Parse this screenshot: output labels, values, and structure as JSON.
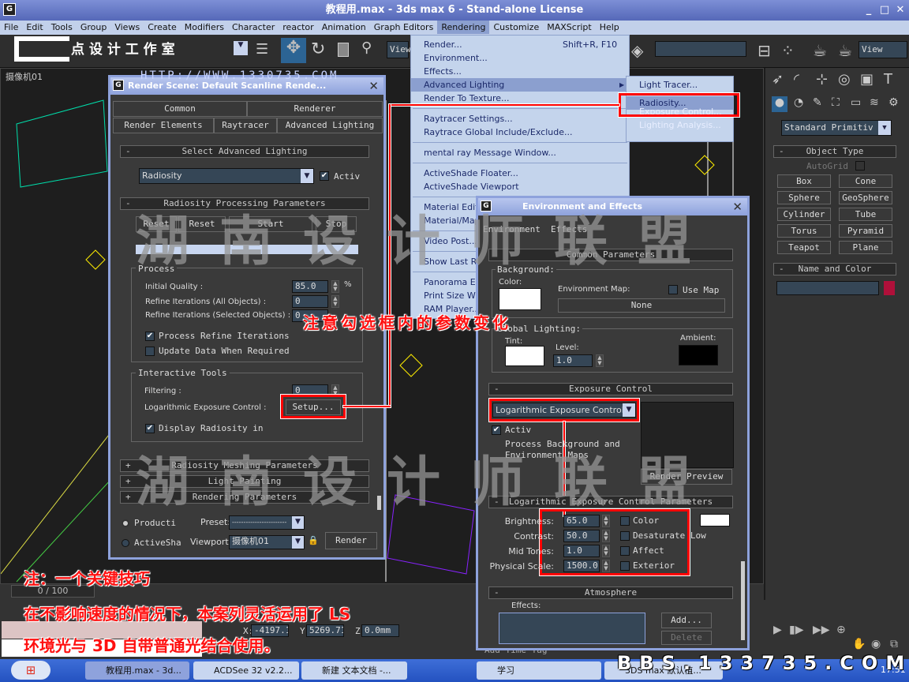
{
  "window": {
    "title": "教程用.max - 3ds max 6 - Stand-alone License"
  },
  "menubar": [
    "File",
    "Edit",
    "Tools",
    "Group",
    "Views",
    "Create",
    "Modifiers",
    "Character",
    "reactor",
    "Animation",
    "Graph Editors",
    "Rendering",
    "Customize",
    "MAXScript",
    "Help"
  ],
  "toolbar": {
    "logo_text": "点 设 计 工 作 室",
    "url_watermark": "HTTP://WWW.1330735.COM",
    "view_left": "View",
    "view_right": "View"
  },
  "viewport": {
    "label": "摄像机01"
  },
  "rendering_menu": {
    "items": [
      {
        "label": "Render...",
        "shortcut": "Shift+R, F10"
      },
      {
        "label": "Environment..."
      },
      {
        "label": "Effects..."
      },
      {
        "label": "Advanced Lighting",
        "submenu": true
      },
      {
        "label": "Render To Texture..."
      },
      {
        "label": "Raytracer Settings..."
      },
      {
        "label": "Raytrace Global Include/Exclude..."
      },
      {
        "label": "mental ray Message Window..."
      },
      {
        "label": "ActiveShade Floater..."
      },
      {
        "label": "ActiveShade Viewport"
      },
      {
        "label": "Material Edito"
      },
      {
        "label": "Material/Map"
      },
      {
        "label": "Video Post..."
      },
      {
        "label": "Show Last Re"
      },
      {
        "label": "Panorama Ex"
      },
      {
        "label": "Print Size Wiz"
      },
      {
        "label": "RAM Player..."
      }
    ],
    "submenu": [
      "Light Tracer...",
      "Radiosity...",
      "Exposure Control...",
      "Lighting Analysis..."
    ]
  },
  "render_scene": {
    "title": "Render Scene: Default Scanline Rende...",
    "tabs_row1": [
      "Common",
      "Renderer"
    ],
    "tabs_row2": [
      "Render Elements",
      "Raytracer",
      "Advanced Lighting"
    ],
    "select_rollout": "Select Advanced Lighting",
    "lighting_select": "Radiosity",
    "active_label": "Activ",
    "active_checked": true,
    "processing_rollout": "Radiosity Processing Parameters",
    "buttons": [
      "Reset All",
      "Reset",
      "Start",
      "Stop"
    ],
    "process_group": "Process",
    "initial_quality_label": "Initial Quality :",
    "initial_quality": "85.0",
    "percent": "%",
    "refine_all_label": "Refine Iterations (All Objects) :",
    "refine_all": "0",
    "refine_sel_label": "Refine Iterations (Selected Objects) :",
    "refine_sel": "0",
    "process_refine_label": "Process Refine Iterations",
    "process_refine_checked": true,
    "update_data_label": "Update Data When Required",
    "update_data_checked": false,
    "interactive_group": "Interactive Tools",
    "filtering_label": "Filtering :",
    "filtering": "0",
    "log_exposure_label": "Logarithmic Exposure Control :",
    "setup_button": "Setup...",
    "display_radiosity_label": "Display Radiosity in",
    "display_radiosity_checked": true,
    "collapsed_rollouts": [
      "Radiosity Meshing Parameters",
      "Light Painting",
      "Rendering Parameters"
    ],
    "production_label": "Producti",
    "activeshade_label": "ActiveSha",
    "preset_label": "Preset:",
    "preset_value": "------------------------",
    "viewport_label": "Viewport:",
    "viewport_value": "摄像机01",
    "render_button": "Render"
  },
  "env_effects": {
    "title": "Environment and Effects",
    "tabs": [
      "Environment",
      "Effects"
    ],
    "common_rollout": "Common Parameters",
    "background_group": "Background:",
    "color_label": "Color:",
    "env_map_label": "Environment Map:",
    "use_map_label": "Use Map",
    "map_button": "None",
    "global_lighting_group": "Global Lighting:",
    "tint_label": "Tint:",
    "level_label": "Level:",
    "level": "1.0",
    "ambient_label": "Ambient:",
    "exposure_rollout": "Exposure Control",
    "exposure_select": "Logarithmic Exposure Control",
    "active_label": "Activ",
    "active_checked": true,
    "process_bg_label": "Process Background and Environment Maps",
    "render_preview_button": "Render Preview",
    "log_rollout": "Logarithmic Exposure Control Parameters",
    "params": [
      {
        "label": "Brightness:",
        "value": "65.0",
        "check": "Color"
      },
      {
        "label": "Contrast:",
        "value": "50.0",
        "check": "Desaturate Low"
      },
      {
        "label": "Mid Tones:",
        "value": "1.0",
        "check": "Affect"
      },
      {
        "label": "Physical Scale:",
        "value": "1500.0",
        "check": "Exterior"
      }
    ],
    "atmosphere_rollout": "Atmosphere",
    "effects_label": "Effects:",
    "add_button": "Add...",
    "delete_button": "Delete"
  },
  "command_panel": {
    "category": "Standard Primitiv",
    "object_type": "Object Type",
    "autogrid": "AutoGrid",
    "buttons": [
      "Box",
      "Cone",
      "Sphere",
      "GeoSphere",
      "Cylinder",
      "Tube",
      "Torus",
      "Pyramid",
      "Teapot",
      "Plane"
    ],
    "name_color": "Name and Color",
    "object_color": "#b0103a"
  },
  "timeline": {
    "frame": "0 / 100"
  },
  "status": {
    "x_label": "X:",
    "x": "-4197.18",
    "y_label": "Y:",
    "y": "5269.712",
    "z_label": "Z:",
    "z": "0.0mm",
    "add_time_tag": "Add Time Tag"
  },
  "annotations": {
    "check_note": "注意勾选框内的参数变化",
    "note_title": "注：一个关键技巧",
    "note_line1": "在不影响速度的情况下，本案列灵活运用了 LS",
    "note_line2": "环境光与 3D 自带普通光结合使用。",
    "bbs": "BBS.133735.COM",
    "watermark": "湖南设计师联盟"
  },
  "taskbar": {
    "items": [
      "教程用.max - 3d...",
      "ACDSee 32 v2.2...",
      "新建 文本文档 -...",
      "学习",
      "3DS max 默认植..."
    ],
    "clock": "17:51"
  },
  "colors": {
    "highlight": "#ff0000",
    "menu_bg": "#c4d4ec",
    "menu_highlight": "#8b9fcf",
    "panel_bg": "#3a3a3a"
  }
}
